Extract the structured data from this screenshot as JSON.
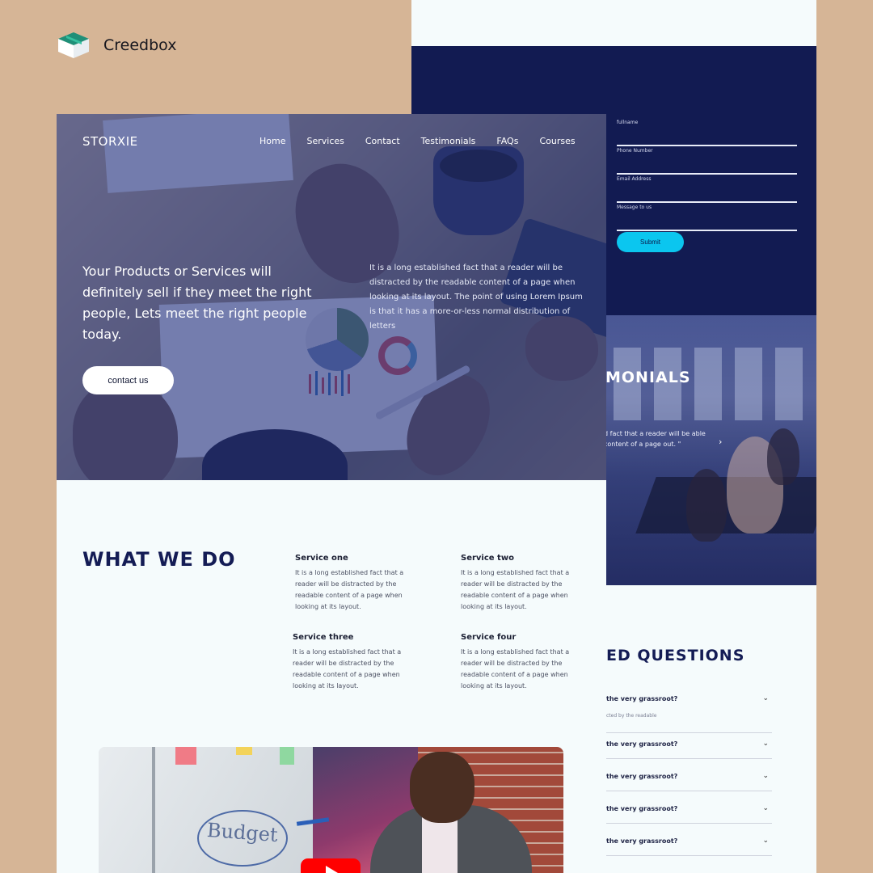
{
  "brand": {
    "name": "Creedbox",
    "logo_icon": "cube-logo-icon"
  },
  "colors": {
    "navy": "#121b52",
    "accent_cyan": "#0bc6ef",
    "page_bg": "#d6b596",
    "light_bg": "#f5fbfc",
    "heading_navy": "#141c55"
  },
  "form": {
    "fields": [
      {
        "label": "fullname"
      },
      {
        "label": "Phone Number"
      },
      {
        "label": "Email Address"
      },
      {
        "label": "Message to us"
      }
    ],
    "submit_label": "Submit"
  },
  "testimonials": {
    "title": "MONIALS",
    "quote": "d fact that a reader will be able content of a page out. \"",
    "next_icon": "chevron-right-icon"
  },
  "faq": {
    "title": "ED QUESTIONS",
    "items": [
      {
        "question": "the very grassroot?",
        "answer": "cted by the readable"
      },
      {
        "question": "the very grassroot?"
      },
      {
        "question": "the very grassroot?"
      },
      {
        "question": "the very grassroot?"
      },
      {
        "question": "the very grassroot?"
      }
    ]
  },
  "site": {
    "logo": "STORXIE",
    "nav": [
      "Home",
      "Services",
      "Contact",
      "Testimonials",
      "FAQs",
      "Courses"
    ],
    "hero": {
      "headline": "Your Products or Services will definitely sell if they meet the right people, Lets meet the right people today.",
      "paragraph": "It is a long established fact that a reader will be distracted by the readable content of a page when looking at its layout. The point of using Lorem Ipsum is that it has a more-or-less normal distribution of letters",
      "cta_label": "contact us"
    },
    "what_we_do": {
      "title": "WHAT WE DO",
      "services": [
        {
          "title": "Service one",
          "text": "It is a long established fact that a reader will be distracted by the readable content of a page when looking at its layout."
        },
        {
          "title": "Service two",
          "text": "It is a long established fact that a reader will be distracted by the readable content of a page when looking at its layout."
        },
        {
          "title": "Service three",
          "text": "It is a long established fact that a reader will be distracted by the readable content of a page when looking at its layout."
        },
        {
          "title": "Service four",
          "text": "It is a long established fact that a reader will be distracted by the readable content of a page when looking at its layout."
        }
      ]
    },
    "video": {
      "board_word": "Budget",
      "play_icon": "youtube-play-icon"
    }
  }
}
